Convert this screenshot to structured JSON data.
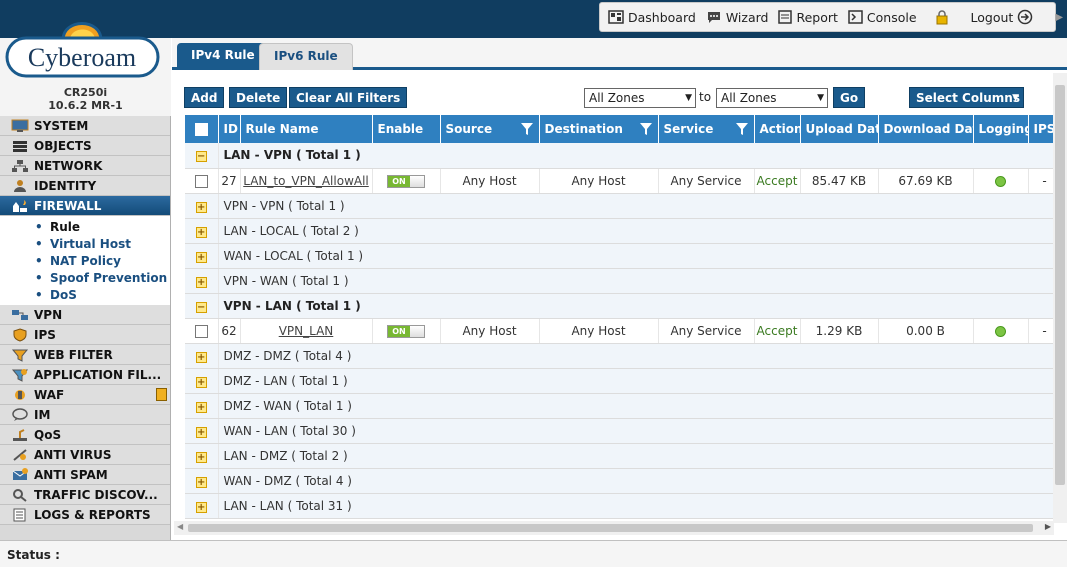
{
  "topnav": {
    "dashboard": "Dashboard",
    "wizard": "Wizard",
    "report": "Report",
    "console": "Console",
    "logout": "Logout"
  },
  "brand": {
    "logo_text": "Cyberoam",
    "model": "CR250i",
    "version": "10.6.2 MR-1"
  },
  "sidebar": {
    "items": [
      {
        "label": "SYSTEM",
        "icon": "monitor-icon"
      },
      {
        "label": "OBJECTS",
        "icon": "stack-icon"
      },
      {
        "label": "NETWORK",
        "icon": "network-icon"
      },
      {
        "label": "IDENTITY",
        "icon": "users-icon"
      },
      {
        "label": "FIREWALL",
        "icon": "firewall-icon"
      },
      {
        "label": "VPN",
        "icon": "vpn-icon"
      },
      {
        "label": "IPS",
        "icon": "shield-icon"
      },
      {
        "label": "WEB FILTER",
        "icon": "filter-icon"
      },
      {
        "label": "APPLICATION FIL...",
        "icon": "app-filter-icon"
      },
      {
        "label": "WAF",
        "icon": "waf-icon"
      },
      {
        "label": "IM",
        "icon": "chat-icon"
      },
      {
        "label": "QoS",
        "icon": "qos-icon"
      },
      {
        "label": "ANTI VIRUS",
        "icon": "virus-icon"
      },
      {
        "label": "ANTI SPAM",
        "icon": "spam-icon"
      },
      {
        "label": "TRAFFIC DISCOV...",
        "icon": "magnifier-icon"
      },
      {
        "label": "LOGS & REPORTS",
        "icon": "logs-icon"
      }
    ],
    "firewall_sub": [
      "Rule",
      "Virtual Host",
      "NAT Policy",
      "Spoof Prevention",
      "DoS"
    ]
  },
  "tabs": [
    "IPv4 Rule",
    "IPv6 Rule"
  ],
  "toolbar": {
    "add": "Add",
    "delete": "Delete",
    "clear_filters": "Clear All Filters",
    "zone_from": "All Zones",
    "to": "to",
    "zone_to": "All Zones",
    "go": "Go",
    "select_columns": "Select Columns"
  },
  "table": {
    "headers": [
      "ID",
      "Rule Name",
      "Enable",
      "Source",
      "Destination",
      "Service",
      "Action",
      "Upload Data",
      "Download Data",
      "Logging",
      "IPS"
    ],
    "groups": [
      {
        "label": "LAN - VPN ( Total 1 )",
        "expanded": true,
        "rule": {
          "id": "27",
          "name": "LAN_to_VPN_AllowAll",
          "enable": "ON",
          "source": "Any Host",
          "destination": "Any Host",
          "service": "Any Service",
          "action": "Accept",
          "upload": "85.47 KB",
          "download": "67.69 KB",
          "ips": "-"
        }
      },
      {
        "label": "VPN - VPN ( Total 1 )",
        "expanded": false
      },
      {
        "label": "LAN - LOCAL ( Total 2 )",
        "expanded": false
      },
      {
        "label": "WAN - LOCAL ( Total 1 )",
        "expanded": false
      },
      {
        "label": "VPN - WAN ( Total 1 )",
        "expanded": false
      },
      {
        "label": "VPN - LAN ( Total 1 )",
        "expanded": true,
        "rule": {
          "id": "62",
          "name": "VPN_LAN",
          "enable": "ON",
          "source": "Any Host",
          "destination": "Any Host",
          "service": "Any Service",
          "action": "Accept",
          "upload": "1.29 KB",
          "download": "0.00 B",
          "ips": "-"
        }
      },
      {
        "label": "DMZ - DMZ ( Total 4 )",
        "expanded": false
      },
      {
        "label": "DMZ - LAN ( Total 1 )",
        "expanded": false
      },
      {
        "label": "DMZ - WAN ( Total 1 )",
        "expanded": false
      },
      {
        "label": "WAN - LAN ( Total 30 )",
        "expanded": false
      },
      {
        "label": "LAN - DMZ ( Total 2 )",
        "expanded": false
      },
      {
        "label": "WAN - DMZ ( Total 4 )",
        "expanded": false
      },
      {
        "label": "LAN - LAN ( Total 31 )",
        "expanded": false
      }
    ]
  },
  "status": {
    "label": "Status :"
  }
}
